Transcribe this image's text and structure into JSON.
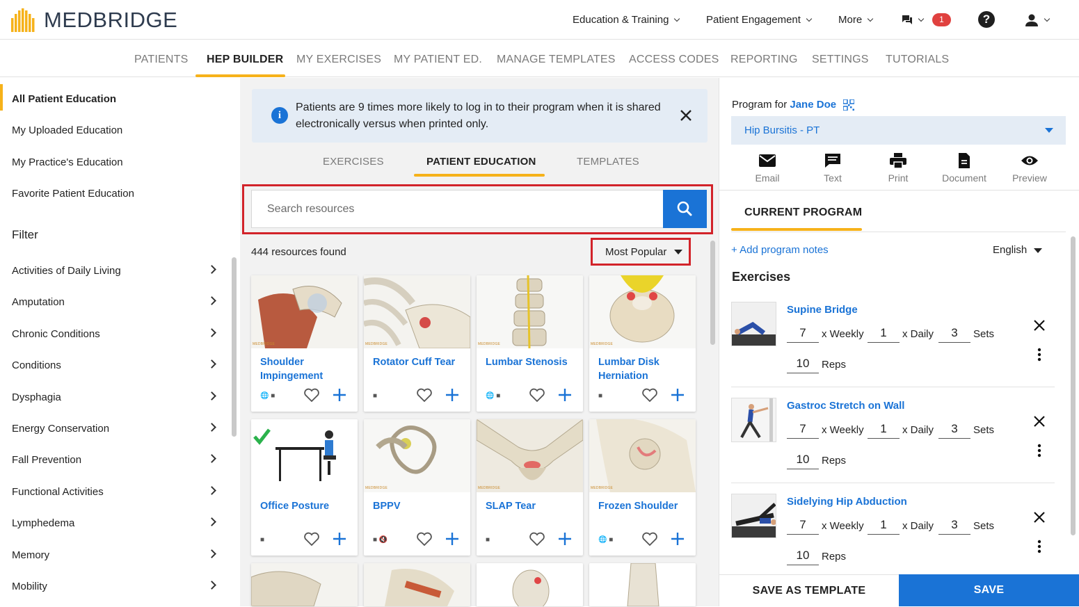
{
  "brand": {
    "name": "MEDBRIDGE",
    "accent": "#f6b21a",
    "primary": "#1a73d6",
    "highlight": "#d2232a"
  },
  "topnav": {
    "items": [
      "Education & Training",
      "Patient Engagement",
      "More"
    ],
    "notifications_count": "1",
    "help_label": "?",
    "icons": [
      "chat-icon",
      "help-icon",
      "user-icon"
    ]
  },
  "tabs": [
    "PATIENTS",
    "HEP BUILDER",
    "MY EXERCISES",
    "MY PATIENT ED.",
    "MANAGE TEMPLATES",
    "ACCESS CODES",
    "REPORTING",
    "SETTINGS",
    "TUTORIALS"
  ],
  "sidebar": {
    "items": [
      "All Patient Education",
      "My Uploaded Education",
      "My Practice's Education",
      "Favorite Patient Education"
    ],
    "filter_title": "Filter",
    "filters": [
      "Activities of Daily Living",
      "Amputation",
      "Chronic Conditions",
      "Conditions",
      "Dysphagia",
      "Energy Conservation",
      "Fall Prevention",
      "Functional Activities",
      "Lymphedema",
      "Memory",
      "Mobility"
    ]
  },
  "banner": {
    "text": "Patients are 9 times more likely to log in to their program when it is shared electronically versus when printed only."
  },
  "center_tabs": [
    "EXERCISES",
    "PATIENT EDUCATION",
    "TEMPLATES"
  ],
  "search": {
    "placeholder": "Search resources"
  },
  "results": {
    "count": "444 resources found",
    "sort": "Most Popular"
  },
  "cards": [
    {
      "title": "Shoulder Impingement",
      "meta": "🌐 ■"
    },
    {
      "title": "Rotator Cuff Tear",
      "meta": "■"
    },
    {
      "title": "Lumbar Stenosis",
      "meta": "🌐 ■"
    },
    {
      "title": "Lumbar Disk Herniation",
      "meta": "■"
    },
    {
      "title": "Office Posture",
      "meta": "■"
    },
    {
      "title": "BPPV",
      "meta": "■ 🔇"
    },
    {
      "title": "SLAP Tear",
      "meta": "■"
    },
    {
      "title": "Frozen Shoulder",
      "meta": "🌐 ■"
    }
  ],
  "program": {
    "for_label": "Program for",
    "patient": "Jane Doe",
    "selected": "Hip Bursitis - PT",
    "share": [
      "Email",
      "Text",
      "Print",
      "Document",
      "Preview"
    ],
    "current_label": "CURRENT PROGRAM",
    "add_notes": "+ Add program notes",
    "language": "English",
    "exercises_label": "Exercises",
    "exercises": [
      {
        "name": "Supine Bridge",
        "weekly": "7",
        "daily": "1",
        "sets": "3",
        "reps": "10"
      },
      {
        "name": "Gastroc Stretch on Wall",
        "weekly": "7",
        "daily": "1",
        "sets": "3",
        "reps": "10"
      },
      {
        "name": "Sidelying Hip Abduction",
        "weekly": "7",
        "daily": "1",
        "sets": "3",
        "reps": "10"
      }
    ],
    "units": {
      "weekly": "x Weekly",
      "daily": "x Daily",
      "sets": "Sets",
      "reps": "Reps"
    },
    "save_template": "SAVE AS TEMPLATE",
    "save": "SAVE"
  }
}
